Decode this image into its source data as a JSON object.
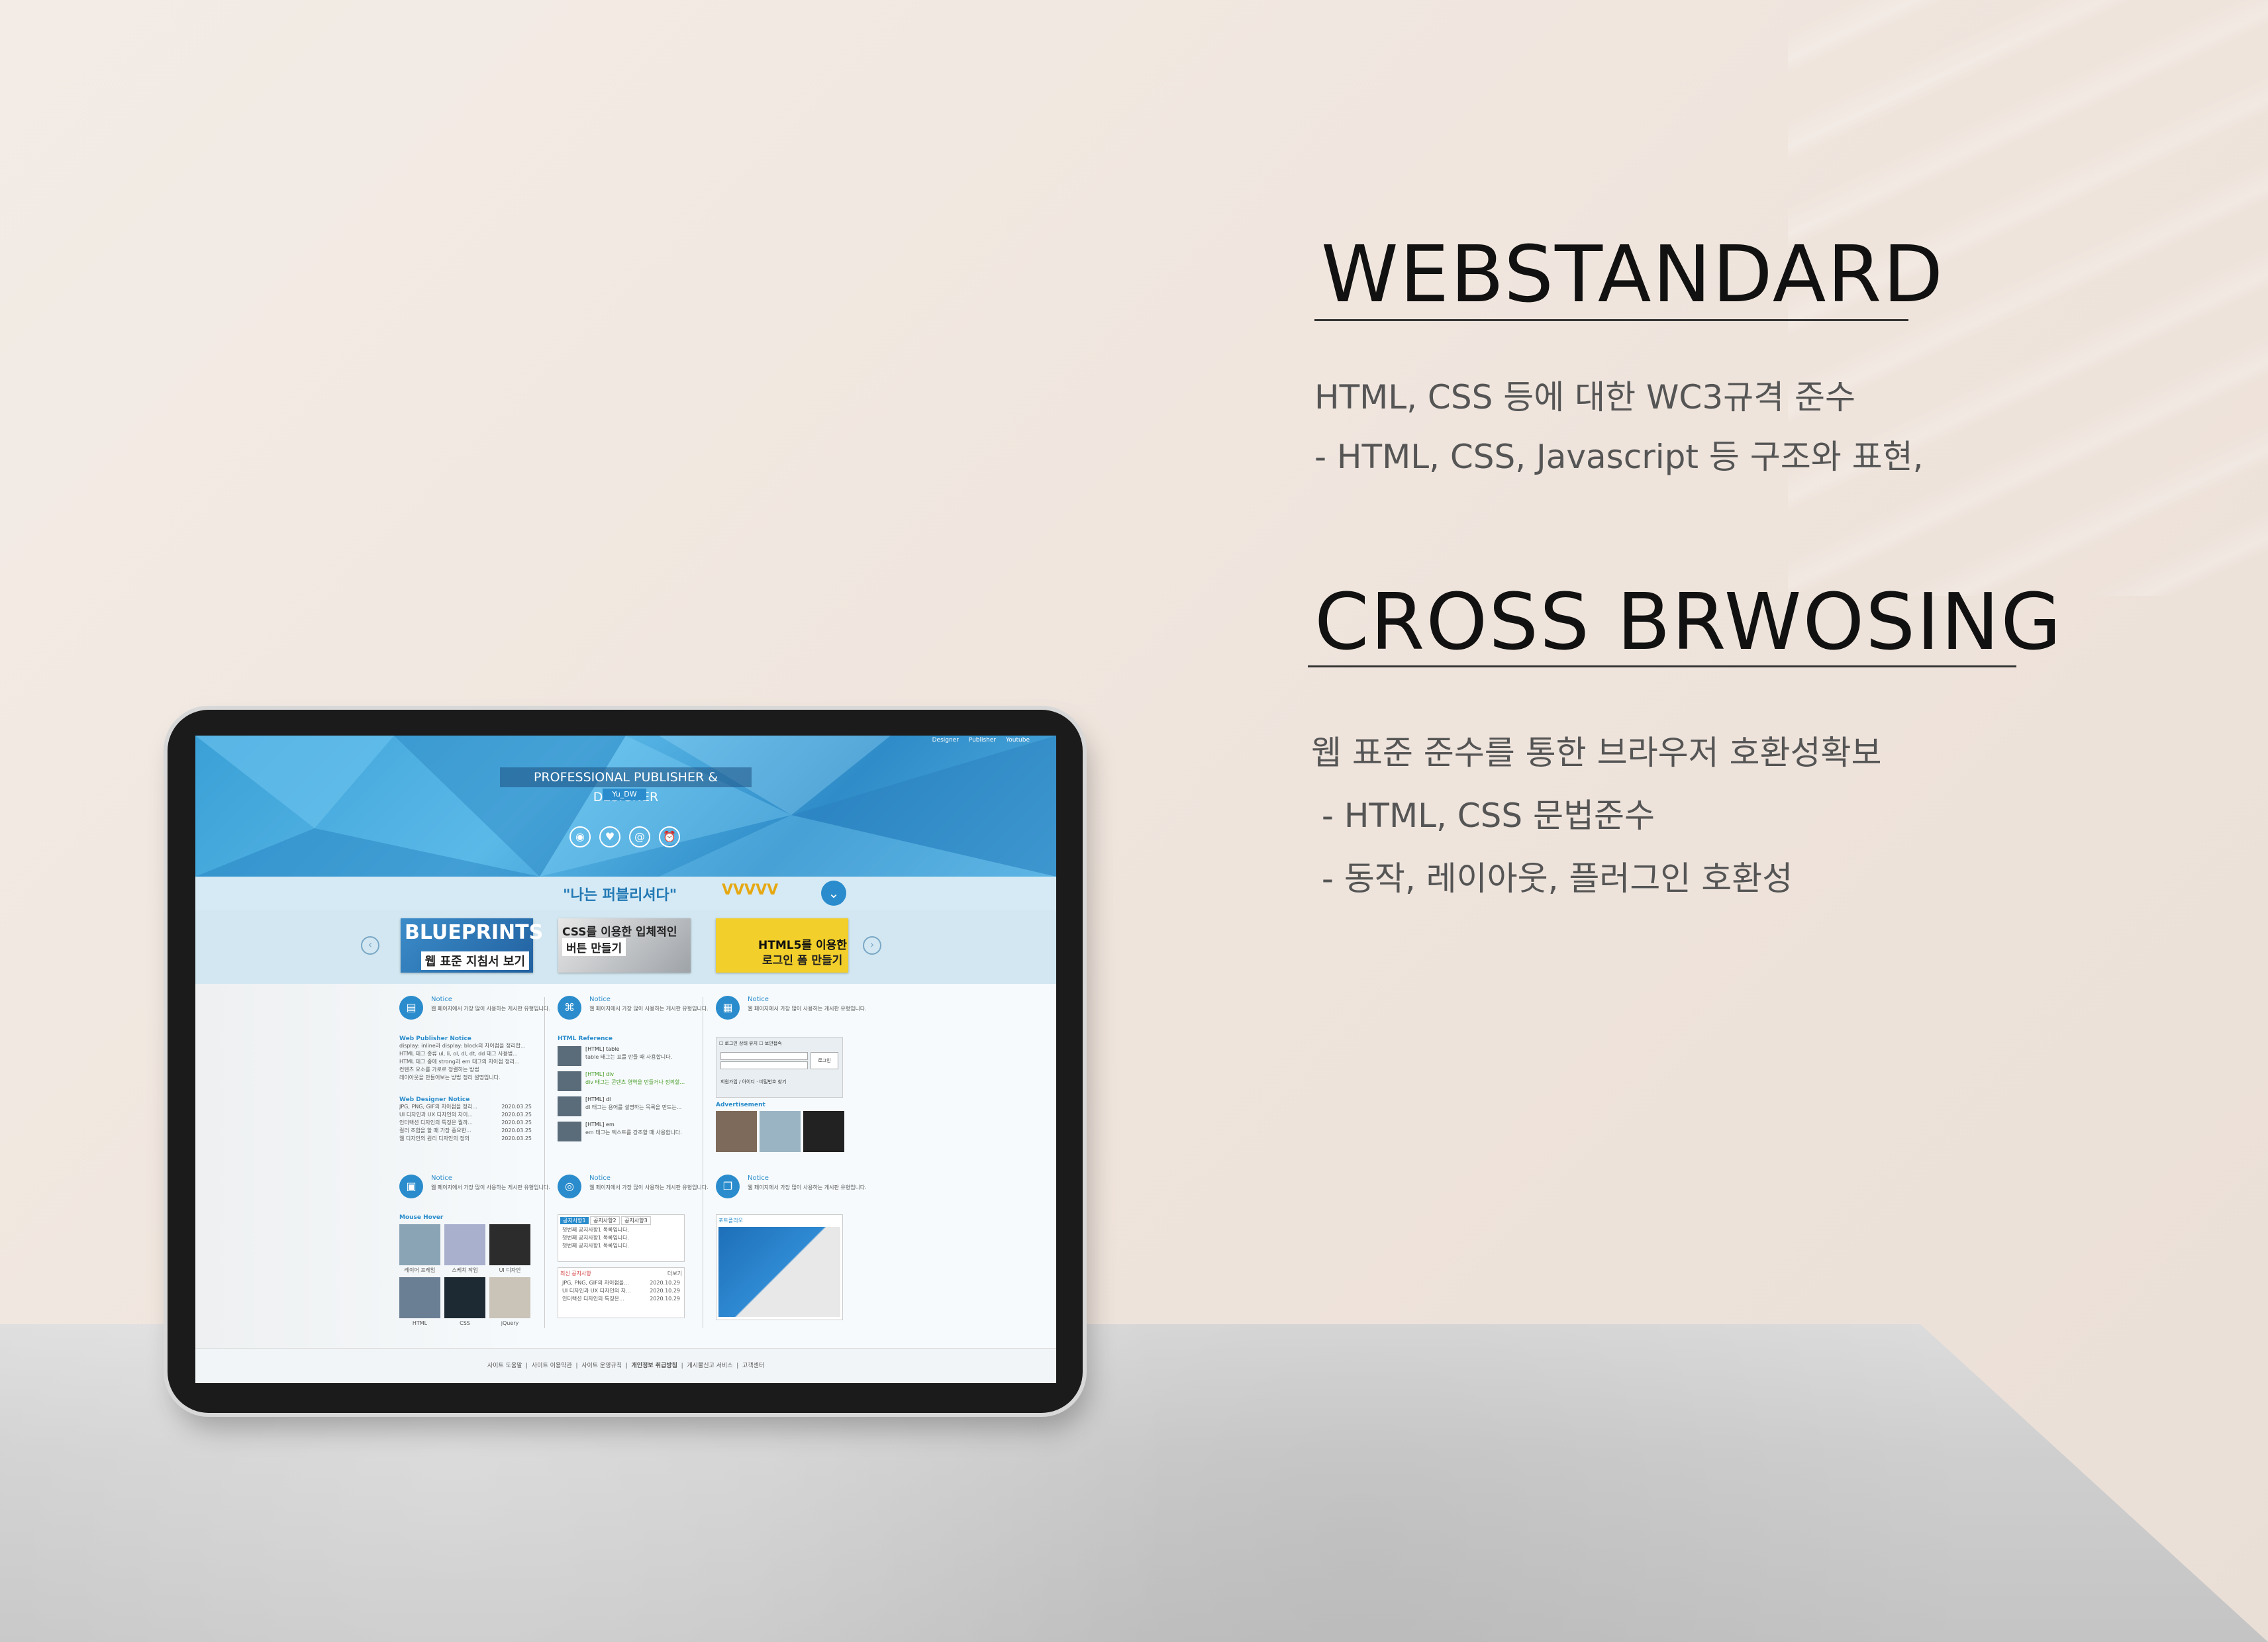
{
  "right": {
    "heading1": "WEBSTANDARD",
    "p1_line1": "HTML, CSS 등에 대한 WC3규격 준수",
    "p1_line2": "- HTML, CSS, Javascript 등 구조와 표현,",
    "heading2": "CROSS BRWOSING",
    "p2_line1": "웹 표준 준수를 통한 브라우저 호환성확보",
    "p2_line2": " - HTML, CSS 문법준수",
    "p2_line3": " - 동작, 레이아웃, 플러그인 호환성"
  },
  "site": {
    "topnav": [
      "Designer",
      "Publisher",
      "Youtube"
    ],
    "hero_title": "PROFESSIONAL PUBLISHER & DESIGNER",
    "hero_sub": "Yu_DW",
    "slogan": "\"나는 퍼블리셔다\"",
    "slogan_accent": "VVVVV",
    "thumbs": [
      {
        "title": "BLUEPRINTS",
        "caption": "웹 표준 지침서 보기"
      },
      {
        "title": "CSS를 이용한 입체적인",
        "caption": "버튼 만들기"
      },
      {
        "title": "HTML5를 이용한",
        "caption": "로그인 폼 만들기"
      }
    ],
    "notice_title": "Notice",
    "notice_desc": "웹 페이지에서 가장 많이 사용하는 게시판 유형입니다.",
    "col1": {
      "sec1": "Web Publisher Notice",
      "list1": [
        "display: inline과 display: block의 차이점을 정리합...",
        "HTML 태그 종류 ul, li, ol, dl, dt, dd 태그 사용법...",
        "HTML 태그 중에 strong과 em 태그의 차이점 정리...",
        "컨텐츠 요소를 가로로 정렬하는 방법",
        "레이아웃을 만들어보는 방법 정리 설명입니다."
      ],
      "sec2": "Web Designer Notice",
      "list2": [
        "JPG, PNG, GIF의 차이점을 정리...",
        "UI 디자인과 UX 디자인의 차이...",
        "인터랙션 디자인의 특징은 뭘까...",
        "컬러 조합을 할 때 가장 중요한...",
        "웹 디자인의 원리 디자인의 정의"
      ],
      "dates2": [
        "2020.03.25",
        "2020.03.25",
        "2020.03.25",
        "2020.03.25",
        "2020.03.25"
      ],
      "sec3": "Mouse Hover",
      "gallery": [
        "레이어 프레임",
        "스케치 작업",
        "UI 디자인",
        "HTML",
        "CSS",
        "jQuery"
      ]
    },
    "col2": {
      "sec1": "HTML Reference",
      "items": [
        {
          "title": "[HTML] table",
          "desc": "table 태그는 표를 만들 때 사용합니다."
        },
        {
          "title": "[HTML] div",
          "desc": "div 태그는 콘텐츠 영역을 만들거나 정의할..."
        },
        {
          "title": "[HTML] dl",
          "desc": "dl 태그는 용어를 설명하는 목록을 만드는..."
        },
        {
          "title": "[HTML] em",
          "desc": "em 태그는 텍스트를 강조할 때 사용합니다."
        }
      ],
      "tabs": [
        "공지사항1",
        "공지사항2",
        "공지사항3"
      ],
      "tab_list": [
        "첫번째 공지사항1 목록입니다.",
        "첫번째 공지사항1 목록입니다.",
        "첫번째 공지사항1 목록입니다."
      ],
      "latest_title": "최신 공지사항",
      "latest_more": "더보기",
      "latest": [
        "JPG, PNG, GIF의 차이점을...",
        "UI 디자인과 UX 디자인의 차...",
        "인터랙션 디자인의 특징은..."
      ],
      "latest_dates": [
        "2020.10.29",
        "2020.10.29",
        "2020.10.29"
      ]
    },
    "col3": {
      "login_save": "로그인 상태 유지",
      "login_security": "보안접속",
      "login_btn": "로그인",
      "login_links": "회원가입 / 아이디 · 비밀번호 찾기",
      "adv_title": "Advertisement",
      "portfolio": "포트폴리오"
    },
    "footer": [
      "사이트 도움말",
      "사이트 이용약관",
      "사이트 운영규칙",
      "개인정보 취급방침",
      "게시물신고 서비스",
      "고객센터"
    ]
  }
}
